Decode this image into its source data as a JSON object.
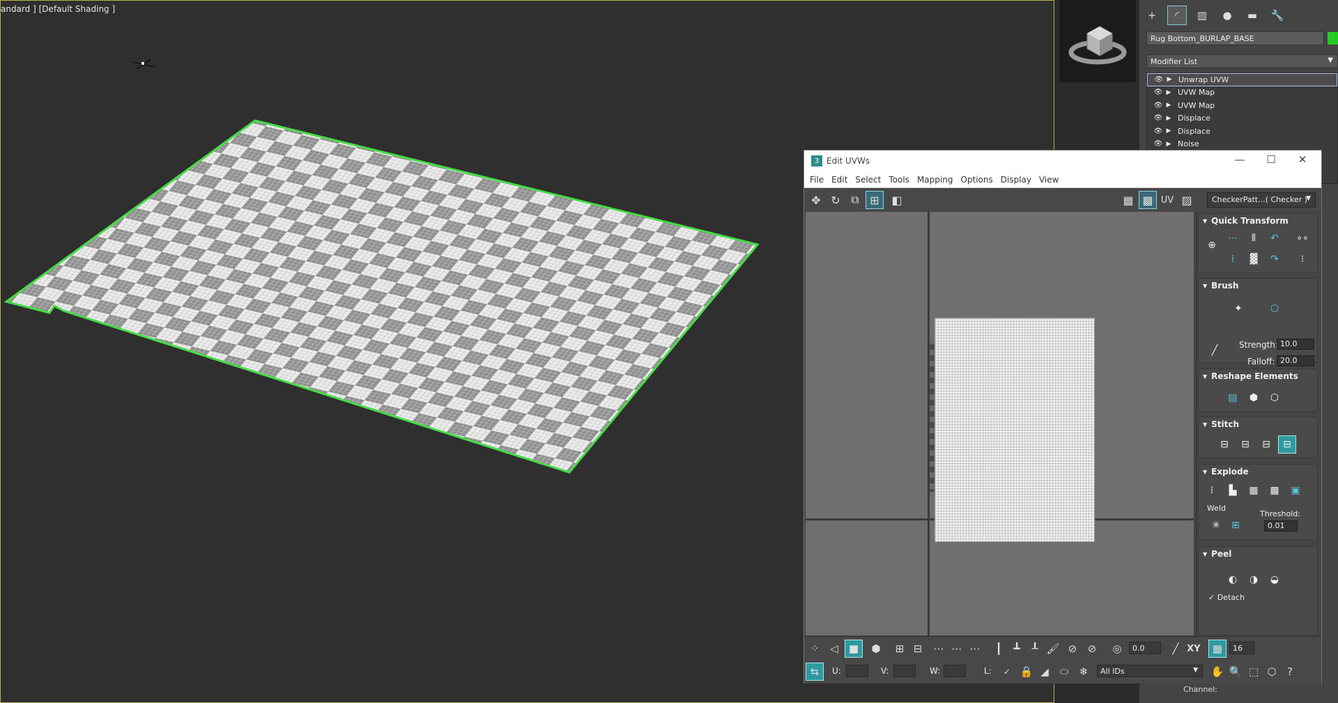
{
  "viewport": {
    "label": "andard ] [Default Shading ]"
  },
  "command_panel": {
    "tabs": [
      {
        "name": "create-tab",
        "icon": "plus-icon"
      },
      {
        "name": "modify-tab",
        "icon": "modify-arc-icon"
      },
      {
        "name": "hierarchy-tab",
        "icon": "hierarchy-icon"
      },
      {
        "name": "motion-tab",
        "icon": "motion-icon"
      },
      {
        "name": "display-tab",
        "icon": "display-icon"
      },
      {
        "name": "utilities-tab",
        "icon": "wrench-icon"
      }
    ],
    "object_name": "Rug Bottom_BURLAP_BASE",
    "object_color": "#22cc22",
    "modifier_list_label": "Modifier List",
    "modifiers": [
      "Unwrap UVW",
      "UVW Map",
      "UVW Map",
      "Displace",
      "Displace",
      "Noise"
    ],
    "channel_label": "Channel:"
  },
  "uvw_window": {
    "title": "Edit UVWs",
    "menu": [
      "File",
      "Edit",
      "Select",
      "Tools",
      "Mapping",
      "Options",
      "Display",
      "View"
    ],
    "uv_label": "UV",
    "texture_select": "CheckerPatt...( Checker )",
    "rollouts": {
      "quick_transform": "Quick Transform",
      "brush": "Brush",
      "strength_label": "Strength:",
      "strength_value": "10.0",
      "falloff_label": "Falloff:",
      "falloff_value": "20.0",
      "reshape": "Reshape Elements",
      "stitch": "Stitch",
      "explode": "Explode",
      "weld": "Weld",
      "threshold_label": "Threshold:",
      "threshold_value": "0.01",
      "peel": "Peel",
      "detach_label": "Detach"
    },
    "bottom": {
      "rotate_value": "0.0",
      "xy_label": "XY",
      "grid_value": "16",
      "u_label": "U:",
      "v_label": "V:",
      "w_label": "W:",
      "l_label": "L:",
      "ids_select": "All IDs"
    }
  }
}
